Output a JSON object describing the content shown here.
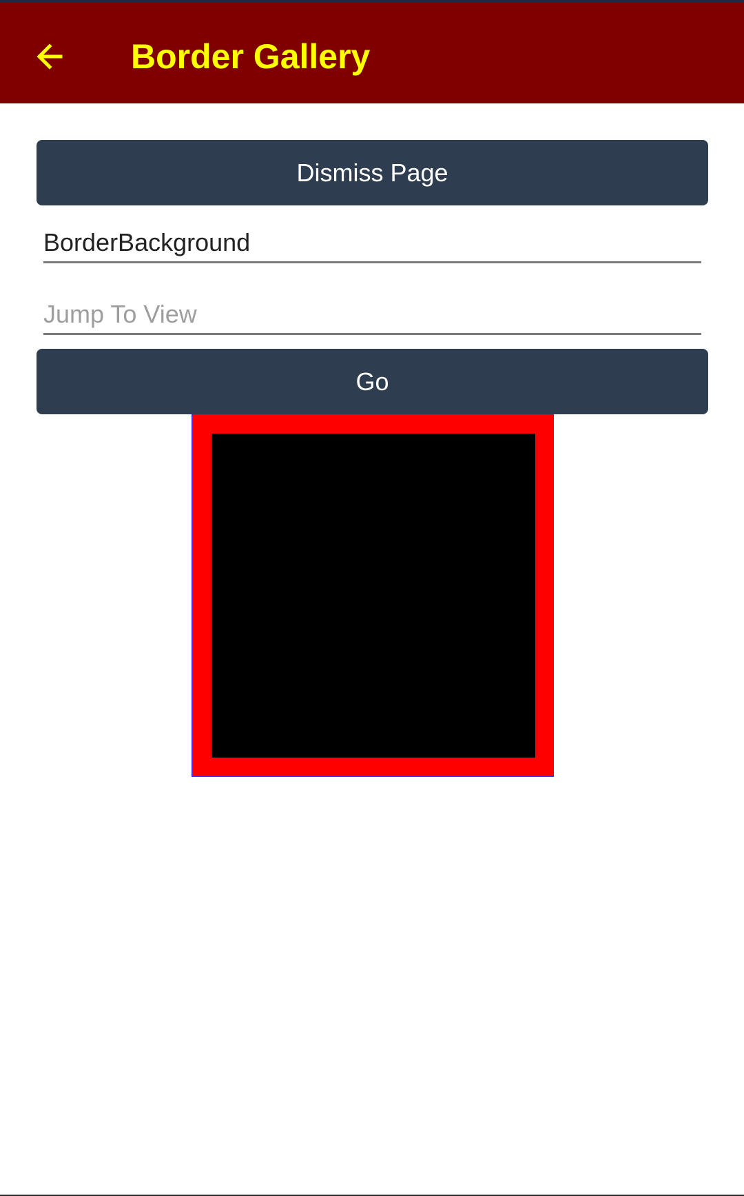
{
  "app_bar": {
    "title": "Border Gallery",
    "back_icon": "arrow-left-icon",
    "background_color": "#800000",
    "title_color": "#ffff00"
  },
  "buttons": {
    "dismiss_label": "Dismiss Page",
    "go_label": "Go",
    "background_color": "#2e3e50"
  },
  "fields": {
    "name_value": "BorderBackground",
    "jump_placeholder": "Jump To View"
  },
  "border_demo": {
    "border_color": "#ff0000",
    "background_color": "#000000"
  }
}
